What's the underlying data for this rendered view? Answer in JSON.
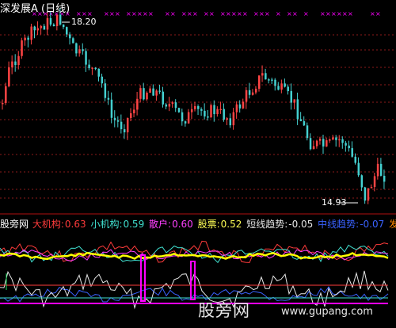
{
  "title": "深发展A (日线)",
  "high_label": "18.20",
  "low_label": "14.93",
  "indicator": {
    "name": "股旁网",
    "items": [
      {
        "label": "大机构:",
        "value": "0.63",
        "color": "#ff3b3b"
      },
      {
        "label": "小机构:",
        "value": "0.59",
        "color": "#40e0d0"
      },
      {
        "label": "散户:",
        "value": "0.60",
        "color": "#ff40ff"
      },
      {
        "label": "股票:",
        "value": "0.52",
        "color": "#ffff55"
      },
      {
        "label": "短线趋势:",
        "value": "-0.05",
        "color": "#e6e6e6"
      },
      {
        "label": "中线趋势:",
        "value": "-0.07",
        "color": "#3a62ff"
      }
    ],
    "trailing": "发"
  },
  "watermark": {
    "name": "股旁网",
    "url": "www.gupang.com"
  },
  "colors": {
    "up": "#ff4444",
    "down": "#44d0d0",
    "grid": "#8b1a1a",
    "magenta": "#ff00ff",
    "yellow": "#ffff00",
    "white": "#ffffff"
  }
}
